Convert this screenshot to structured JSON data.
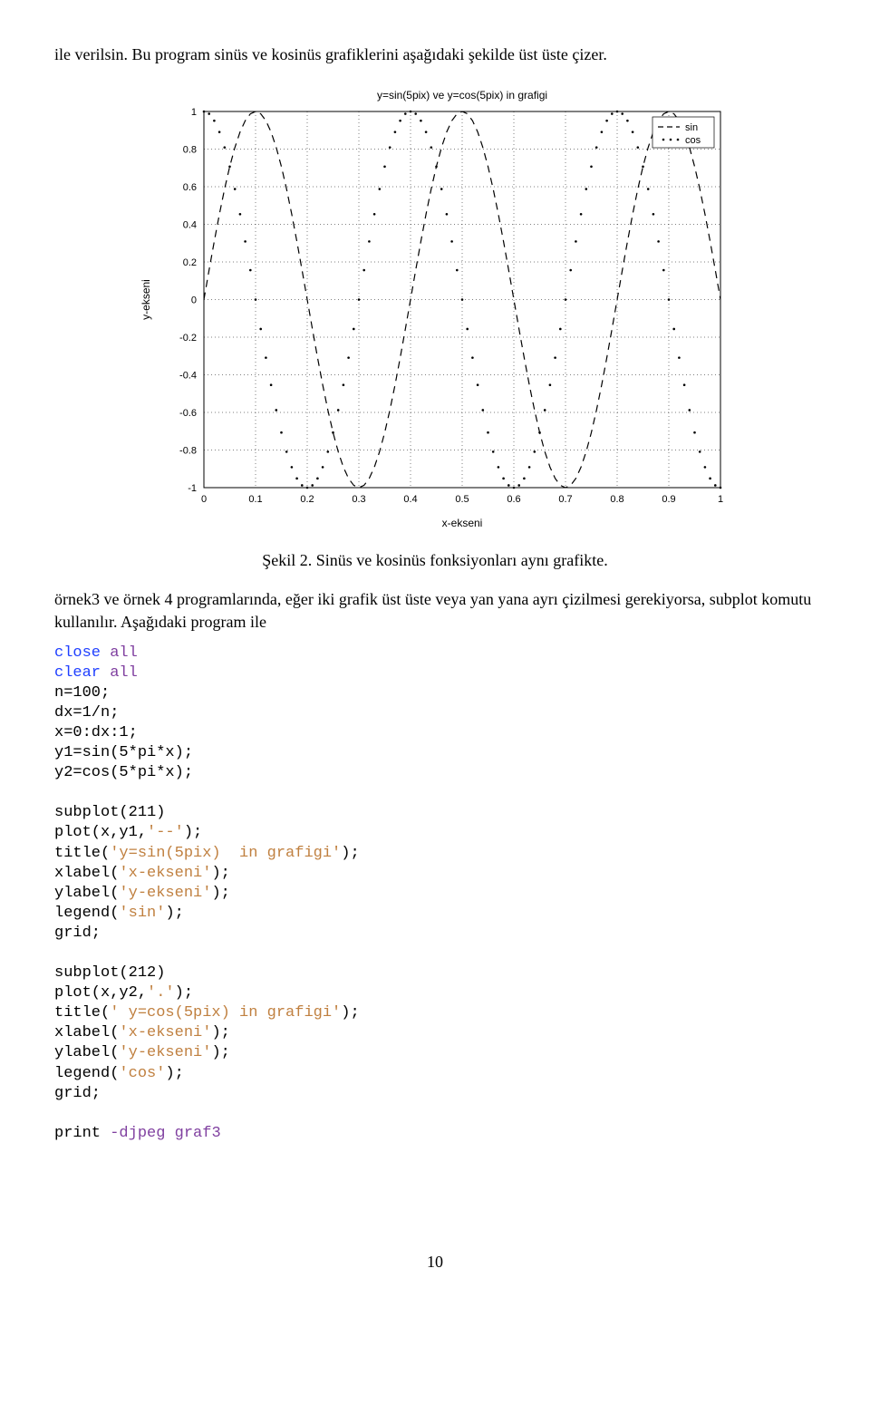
{
  "text": {
    "p1": "ile verilsin. Bu program sinüs ve kosinüs grafiklerini aşağıdaki şekilde üst üste çizer.",
    "caption": "Şekil 2. Sinüs ve kosinüs fonksiyonları aynı grafikte.",
    "p2": "örnek3 ve örnek 4 programlarında, eğer iki grafik üst üste veya yan yana ayrı çizilmesi gerekiyorsa, subplot  komutu kullanılır. Aşağıdaki program ile",
    "page": "10"
  },
  "code": {
    "lines": [
      {
        "t": "close ",
        "c": "blue"
      },
      {
        "t": "all\n",
        "c": "mag"
      },
      {
        "t": "clear ",
        "c": "blue"
      },
      {
        "t": "all\n",
        "c": "mag"
      },
      {
        "t": "n=100;\n"
      },
      {
        "t": "dx=1/n;\n"
      },
      {
        "t": "x=0:dx:1;\n"
      },
      {
        "t": "y1=sin(5*pi*x);\n"
      },
      {
        "t": "y2=cos(5*pi*x);\n"
      },
      {
        "t": "\n"
      },
      {
        "t": "subplot(211)\n"
      },
      {
        "t": "plot(x,y1,"
      },
      {
        "t": "'--'",
        "c": "red"
      },
      {
        "t": ");\n"
      },
      {
        "t": "title("
      },
      {
        "t": "'y=sin(5pix)  in grafigi'",
        "c": "red"
      },
      {
        "t": ");\n"
      },
      {
        "t": "xlabel("
      },
      {
        "t": "'x-ekseni'",
        "c": "red"
      },
      {
        "t": ");\n"
      },
      {
        "t": "ylabel("
      },
      {
        "t": "'y-ekseni'",
        "c": "red"
      },
      {
        "t": ");\n"
      },
      {
        "t": "legend("
      },
      {
        "t": "'sin'",
        "c": "red"
      },
      {
        "t": ");\n"
      },
      {
        "t": "grid;\n"
      },
      {
        "t": "\n"
      },
      {
        "t": "subplot(212)\n"
      },
      {
        "t": "plot(x,y2,"
      },
      {
        "t": "'.'",
        "c": "red"
      },
      {
        "t": ");\n"
      },
      {
        "t": "title("
      },
      {
        "t": "' y=cos(5pix) in grafigi'",
        "c": "red"
      },
      {
        "t": ");\n"
      },
      {
        "t": "xlabel("
      },
      {
        "t": "'x-ekseni'",
        "c": "red"
      },
      {
        "t": ");\n"
      },
      {
        "t": "ylabel("
      },
      {
        "t": "'y-ekseni'",
        "c": "red"
      },
      {
        "t": ");\n"
      },
      {
        "t": "legend("
      },
      {
        "t": "'cos'",
        "c": "red"
      },
      {
        "t": ");\n"
      },
      {
        "t": "grid;\n"
      },
      {
        "t": "\n"
      },
      {
        "t": "print "
      },
      {
        "t": "-djpeg",
        "c": "mag"
      },
      {
        "t": " "
      },
      {
        "t": "graf3",
        "c": "mag"
      }
    ]
  },
  "chart_data": {
    "type": "line",
    "title": "y=sin(5pix) ve y=cos(5pix) in grafigi",
    "xlabel": "x-ekseni",
    "ylabel": "y-ekseni",
    "xlim": [
      0,
      1
    ],
    "ylim": [
      -1,
      1
    ],
    "xticks": [
      0,
      0.1,
      0.2,
      0.3,
      0.4,
      0.5,
      0.6,
      0.7,
      0.8,
      0.9,
      1
    ],
    "yticks": [
      -1,
      -0.8,
      -0.6,
      -0.4,
      -0.2,
      0,
      0.2,
      0.4,
      0.6,
      0.8,
      1
    ],
    "legend": [
      "sin",
      "cos"
    ],
    "sin_style": "dashed-line",
    "cos_style": "dots",
    "n_points": 101,
    "series": [
      {
        "name": "sin",
        "formula": "sin(5*pi*x)",
        "x_range": "0:0.01:1"
      },
      {
        "name": "cos",
        "formula": "cos(5*pi*x)",
        "x_range": "0:0.01:1"
      }
    ]
  }
}
